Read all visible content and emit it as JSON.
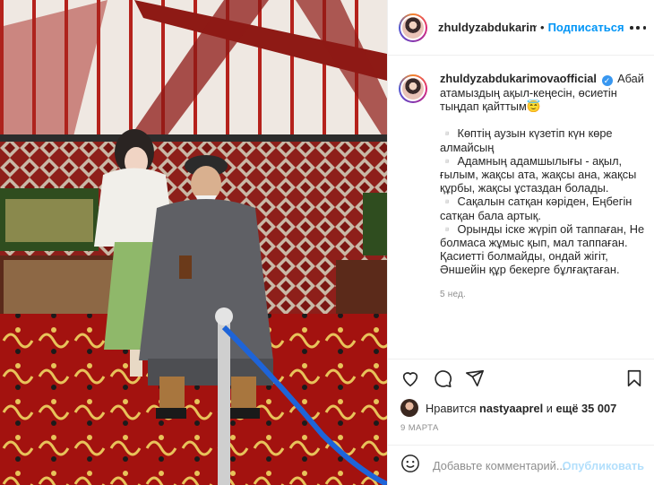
{
  "post": {
    "username": "zhuldyzabdukarimovaofficial",
    "header_username": "zhuldyzabdukarimovaofficial",
    "dot": "•",
    "follow_label": "Подписаться",
    "caption_intro": "Абай атамыздың ақыл-кеңесін, өсиетін тыңдап қайттым😇",
    "caption_lines": [
      "▫️ Көптің аузын күзетіп күн көре алмайсың",
      "▫️ Адамның адамшылығы - ақыл, ғылым, жақсы ата, жақсы ана, жақсы құрбы, жақсы ұстаздан болады.",
      "▫️ Сақалын сатқан кәріден, Еңбегін сатқан бала артық.",
      "▫️ Орынды іске жүріп ой таппаған, Не болмаса жұмыс қып, мал таппаған. Қасиетті болмайды, ондай жігіт, Әншейін құр бекерге бұлғақтаған."
    ],
    "timestamp": "5 нед.",
    "liked_by_prefix": "Нравится ",
    "liked_by_user": "nastyaaprel",
    "liked_by_mid": " и ",
    "liked_by_rest": "ещё 35 007",
    "date": "9 МАРТА",
    "comment_placeholder": "Добавьте комментарий...",
    "publish_label": "Опубликовать"
  },
  "icons": {
    "like": "heart-icon",
    "comment": "comment-icon",
    "share": "share-icon",
    "save": "bookmark-icon",
    "emoji": "emoji-icon",
    "more": "more-icon"
  },
  "colors": {
    "accent": "#0095f6",
    "muted": "#8e8e8e",
    "text": "#262626"
  }
}
